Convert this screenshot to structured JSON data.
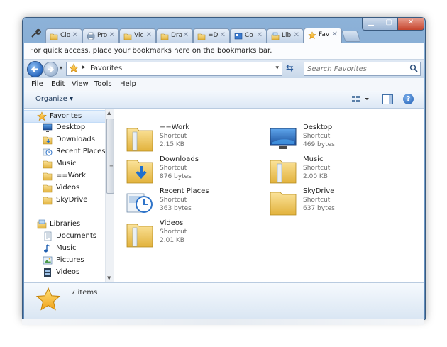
{
  "browser": {
    "tabs": [
      {
        "label": "Clo",
        "icon": "folder-icon",
        "active": false
      },
      {
        "label": "Pro",
        "icon": "printer-icon",
        "active": false
      },
      {
        "label": "Vic",
        "icon": "folder-icon",
        "active": false
      },
      {
        "label": "Dra",
        "icon": "folder-icon",
        "active": false
      },
      {
        "label": "=D",
        "icon": "folder-icon",
        "active": false
      },
      {
        "label": "Co",
        "icon": "control-panel-icon",
        "active": false
      },
      {
        "label": "Lib",
        "icon": "libraries-icon",
        "active": false
      },
      {
        "label": "Fav",
        "icon": "star-icon",
        "active": true
      }
    ],
    "tab_close": "✕",
    "bookmarks_hint": "For quick access, place your bookmarks here on the bookmarks bar."
  },
  "window_controls": {
    "minimize": "▁",
    "maximize": "▢",
    "close": "✕"
  },
  "address": {
    "separator": "▸",
    "path": "Favorites",
    "search_placeholder": "Search Favorites"
  },
  "menu": [
    "File",
    "Edit",
    "View",
    "Tools",
    "Help"
  ],
  "toolbar": {
    "organize": "Organize ▾",
    "help": "?"
  },
  "nav": {
    "favorites": {
      "header": "Favorites",
      "items": [
        {
          "label": "Desktop",
          "icon": "desktop-icon"
        },
        {
          "label": "Downloads",
          "icon": "downloads-icon"
        },
        {
          "label": "Recent Places",
          "icon": "recent-places-icon"
        },
        {
          "label": "Music",
          "icon": "folder-icon"
        },
        {
          "label": "==Work",
          "icon": "folder-icon"
        },
        {
          "label": "Videos",
          "icon": "folder-icon"
        },
        {
          "label": "SkyDrive",
          "icon": "folder-icon"
        }
      ]
    },
    "libraries": {
      "header": "Libraries",
      "items": [
        {
          "label": "Documents",
          "icon": "documents-icon"
        },
        {
          "label": "Music",
          "icon": "music-note-icon"
        },
        {
          "label": "Pictures",
          "icon": "pictures-icon"
        },
        {
          "label": "Videos",
          "icon": "film-icon"
        }
      ]
    }
  },
  "files": [
    {
      "name": "==Work",
      "type": "Shortcut",
      "size": "2.15 KB",
      "icon": "folder-icon"
    },
    {
      "name": "Desktop",
      "type": "Shortcut",
      "size": "469 bytes",
      "icon": "desktop-icon"
    },
    {
      "name": "Downloads",
      "type": "Shortcut",
      "size": "876 bytes",
      "icon": "downloads-icon"
    },
    {
      "name": "Music",
      "type": "Shortcut",
      "size": "2.00 KB",
      "icon": "folder-icon"
    },
    {
      "name": "Recent Places",
      "type": "Shortcut",
      "size": "363 bytes",
      "icon": "recent-places-icon"
    },
    {
      "name": "SkyDrive",
      "type": "Shortcut",
      "size": "637 bytes",
      "icon": "folder-icon"
    },
    {
      "name": "Videos",
      "type": "Shortcut",
      "size": "2.01 KB",
      "icon": "folder-icon"
    }
  ],
  "status": {
    "count": "7 items"
  },
  "colors": {
    "accent": "#2a69c0",
    "folder": "#f2c94c",
    "window_frame": "#6f9ac7"
  }
}
